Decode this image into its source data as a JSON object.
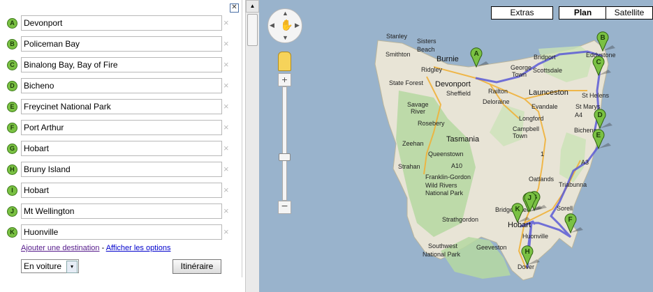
{
  "destinations": [
    {
      "letter": "A",
      "value": "Devonport"
    },
    {
      "letter": "B",
      "value": "Policeman Bay"
    },
    {
      "letter": "C",
      "value": "Binalong Bay, Bay of Fire"
    },
    {
      "letter": "D",
      "value": "Bicheno"
    },
    {
      "letter": "E",
      "value": "Freycinet National Park"
    },
    {
      "letter": "F",
      "value": "Port Arthur"
    },
    {
      "letter": "G",
      "value": "Hobart"
    },
    {
      "letter": "H",
      "value": "Bruny Island"
    },
    {
      "letter": "I",
      "value": "Hobart"
    },
    {
      "letter": "J",
      "value": "Mt Wellington"
    },
    {
      "letter": "K",
      "value": "Huonville"
    }
  ],
  "remove_glyph": "×",
  "close_glyph": "✕",
  "links": {
    "add": "Ajouter une destination",
    "sep": " - ",
    "options": "Afficher les options"
  },
  "mode": {
    "selected": "En voiture",
    "arrow": "▾"
  },
  "route_button": "Itinéraire",
  "footer_text": "",
  "map": {
    "types": {
      "extras": "Extras",
      "plan": "Plan",
      "satellite": "Satellite"
    },
    "places": [
      "Stanley",
      "Sisters",
      "Beach",
      "Smithton",
      "Burnie",
      "Bridport",
      "George",
      "Town",
      "Scottsdale",
      "Devonport",
      "Ridgley",
      "Railton",
      "Sheffield",
      "Launceston",
      "St Helens",
      "State Forest",
      "Savage",
      "River",
      "Deloraine",
      "Evandale",
      "St Marys",
      "Longford",
      "Campbell",
      "Town",
      "Bicheno",
      "Rosebery",
      "Zeehan",
      "Tasmania",
      "Queenstown",
      "Strahan",
      "Franklin-Gordon",
      "Wild Rivers",
      "National Park",
      "Oatlands",
      "Triabunna",
      "Bridgewater",
      "Sorell",
      "Strathgordon",
      "Hobart",
      "Southwest",
      "National Park",
      "Geeveston",
      "Dover",
      "Huonville",
      "Eddystone",
      "A4",
      "A10",
      "A3",
      "1"
    ],
    "route_color": "#5a5ad6"
  }
}
